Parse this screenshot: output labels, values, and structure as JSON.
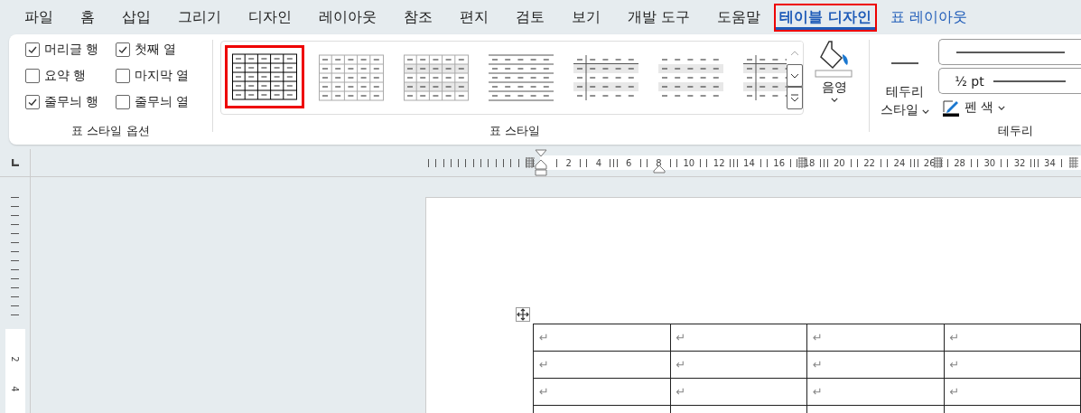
{
  "menu_tabs": [
    {
      "label": "파일",
      "kind": "normal",
      "selected": false,
      "highlighted": false
    },
    {
      "label": "홈",
      "kind": "normal",
      "selected": false,
      "highlighted": false
    },
    {
      "label": "삽입",
      "kind": "normal",
      "selected": false,
      "highlighted": false
    },
    {
      "label": "그리기",
      "kind": "normal",
      "selected": false,
      "highlighted": false
    },
    {
      "label": "디자인",
      "kind": "normal",
      "selected": false,
      "highlighted": false
    },
    {
      "label": "레이아웃",
      "kind": "normal",
      "selected": false,
      "highlighted": false
    },
    {
      "label": "참조",
      "kind": "normal",
      "selected": false,
      "highlighted": false
    },
    {
      "label": "편지",
      "kind": "normal",
      "selected": false,
      "highlighted": false
    },
    {
      "label": "검토",
      "kind": "normal",
      "selected": false,
      "highlighted": false
    },
    {
      "label": "보기",
      "kind": "normal",
      "selected": false,
      "highlighted": false
    },
    {
      "label": "개발 도구",
      "kind": "normal",
      "selected": false,
      "highlighted": false
    },
    {
      "label": "도움말",
      "kind": "normal",
      "selected": false,
      "highlighted": false
    },
    {
      "label": "테이블 디자인",
      "kind": "contextual",
      "selected": true,
      "highlighted": true
    },
    {
      "label": "표 레이아웃",
      "kind": "contextual",
      "selected": false,
      "highlighted": false
    }
  ],
  "ribbon": {
    "style_options": {
      "title": "표 스타일 옵션",
      "options": [
        {
          "label": "머리글 행",
          "checked": true
        },
        {
          "label": "첫째 열",
          "checked": true
        },
        {
          "label": "요약 행",
          "checked": false
        },
        {
          "label": "마지막 열",
          "checked": false
        },
        {
          "label": "줄무늬 행",
          "checked": true
        },
        {
          "label": "줄무늬 열",
          "checked": false
        }
      ]
    },
    "table_styles": {
      "title": "표 스타일",
      "styles": [
        {
          "kind": "grid",
          "highlighted": true
        },
        {
          "kind": "light-grid",
          "highlighted": false
        },
        {
          "kind": "banded-grid",
          "highlighted": false
        },
        {
          "kind": "lines",
          "highlighted": false
        },
        {
          "kind": "first-column-banded",
          "highlighted": false
        },
        {
          "kind": "banded",
          "highlighted": false
        },
        {
          "kind": "first-column-lines",
          "highlighted": false
        }
      ]
    },
    "shading": {
      "label": "음영"
    },
    "borders": {
      "title": "테두리",
      "style_label": "테두리 스타일",
      "weight": "½ pt",
      "pen_color_label": "펜 색"
    }
  },
  "ruler": {
    "horizontal": [
      "2",
      "4",
      "6",
      "8",
      "10",
      "12",
      "14",
      "16",
      "18",
      "20",
      "22",
      "24",
      "26",
      "28",
      "30",
      "32",
      "34"
    ],
    "vertical": [
      "2",
      "4"
    ]
  },
  "document_table": {
    "rows": [
      [
        "↵",
        "↵",
        "↵",
        "↵"
      ],
      [
        "↵",
        "↵",
        "↵",
        "↵"
      ],
      [
        "↵",
        "↵",
        "↵",
        "↵"
      ]
    ]
  }
}
